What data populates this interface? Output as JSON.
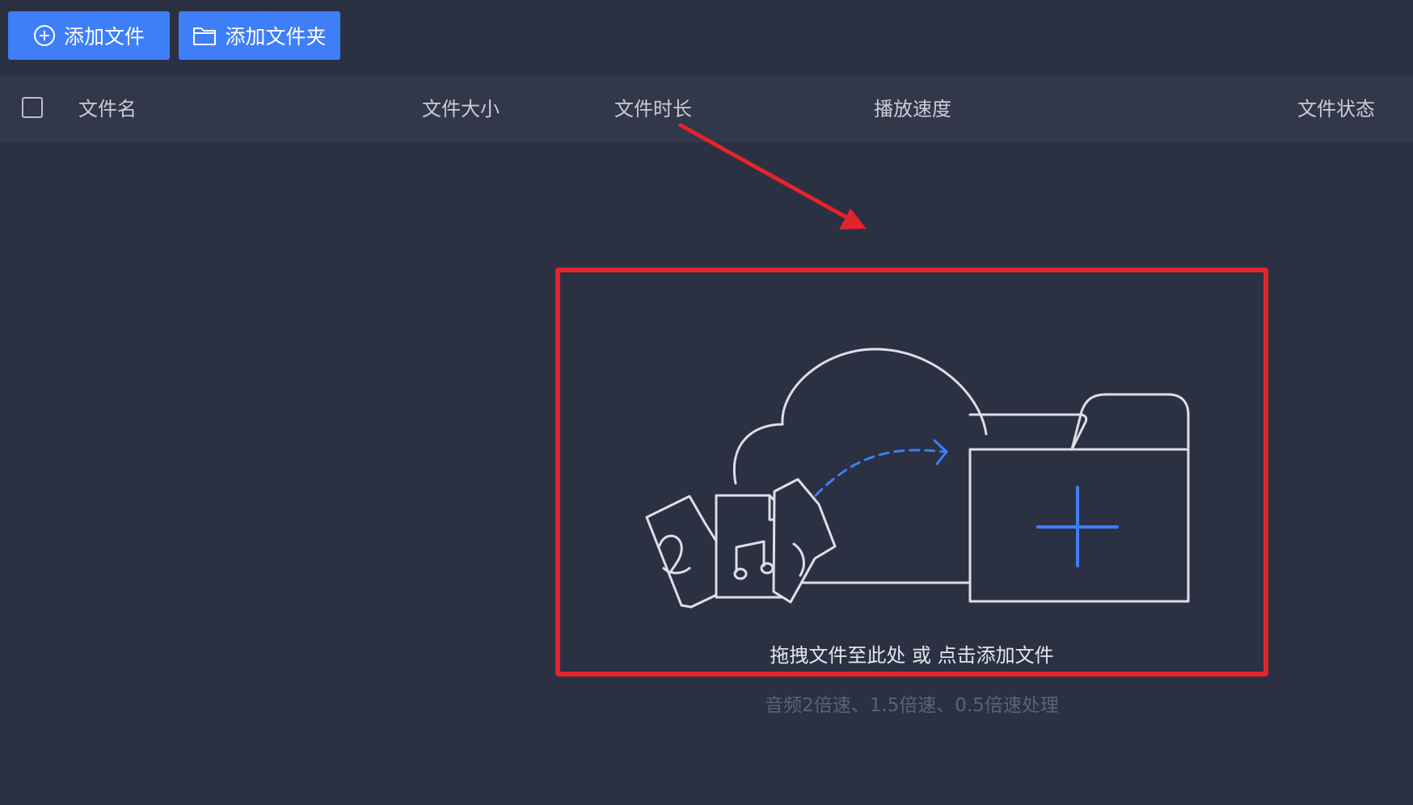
{
  "toolbar": {
    "add_file_label": "添加文件",
    "add_folder_label": "添加文件夹",
    "accent": "#3e7ef7"
  },
  "table": {
    "columns": [
      "文件名",
      "文件大小",
      "文件时长",
      "播放速度",
      "文件状态"
    ]
  },
  "dropzone": {
    "label": "拖拽文件至此处 或 点击添加文件",
    "hint": "音频2倍速、1.5倍速、0.5倍速处理"
  },
  "annotation": {
    "color": "#e3242b"
  }
}
